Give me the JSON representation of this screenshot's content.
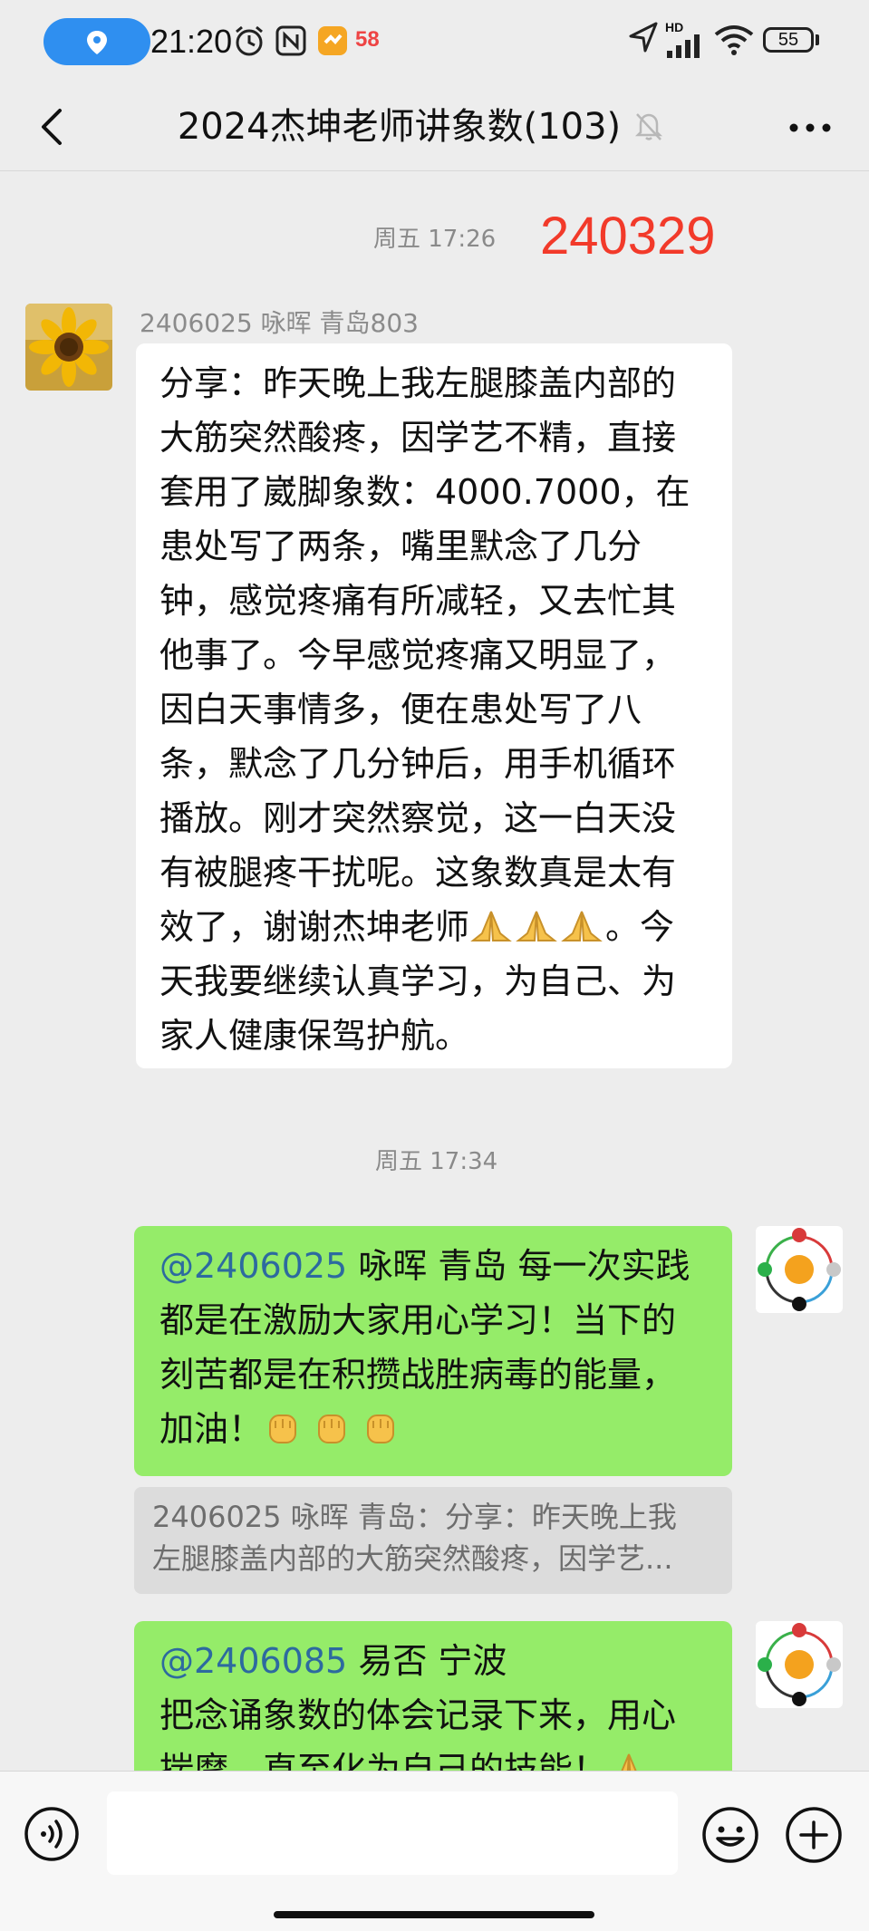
{
  "status_bar": {
    "time": "21:20",
    "app_badge": "58",
    "battery": "55",
    "network_badge": "HD"
  },
  "header": {
    "title": "2024杰坤老师讲象数(103)",
    "back_icon": "chevron-left-icon",
    "mute_icon": "bell-off-icon",
    "more_icon": "more-dots-icon"
  },
  "chat": {
    "timestamp_1": "周五 17:26",
    "red_date": "240329",
    "message_1": {
      "sender": "2406025  咏晖 青岛803",
      "lines": [
        "分享：昨天晚上我左腿膝盖内部的",
        "大筋突然酸疼，因学艺不精，直接",
        "套用了崴脚象数：4000.7000，在",
        "患处写了两条，嘴里默念了几分",
        "钟，感觉疼痛有所减轻，又去忙其",
        "他事了。今早感觉疼痛又明显了，",
        "因白天事情多，便在患处写了八",
        "条，默念了几分钟后，用手机循环",
        "播放。刚才突然察觉，这一白天没",
        "有被腿疼干扰呢。这象数真是太有",
        "效了，谢谢杰坤老师",
        "。今",
        "天我要继续认真学习，为自己、为",
        "家人健康保驾护航。"
      ]
    },
    "timestamp_2": "周五 17:34",
    "message_2": {
      "mention": "@2406025",
      "lines": [
        " 咏晖 青岛 每一次实践",
        "都是在激励大家用心学习！当下的",
        "刻苦都是在积攒战胜病毒的能量，",
        "加油！"
      ],
      "quote": [
        "2406025  咏晖 青岛：分享：昨天晚上我",
        "左腿膝盖内部的大筋突然酸疼，因学艺..."
      ]
    },
    "message_3": {
      "mention": "@2406085",
      "lines": [
        " 易否 宁波",
        "把念诵象数的体会记录下来，用心",
        "揣摩，直至化为自己的技能！"
      ]
    }
  },
  "input_bar": {
    "voice_icon": "voice-icon",
    "emoji_icon": "smile-icon",
    "plus_icon": "plus-icon"
  },
  "colors": {
    "background": "#ededed",
    "bubble_self": "#95ec69",
    "bubble_other": "#ffffff",
    "red_date": "#f23a2a",
    "mention": "#2d6a9f",
    "location_pill": "#2f8ff0"
  }
}
